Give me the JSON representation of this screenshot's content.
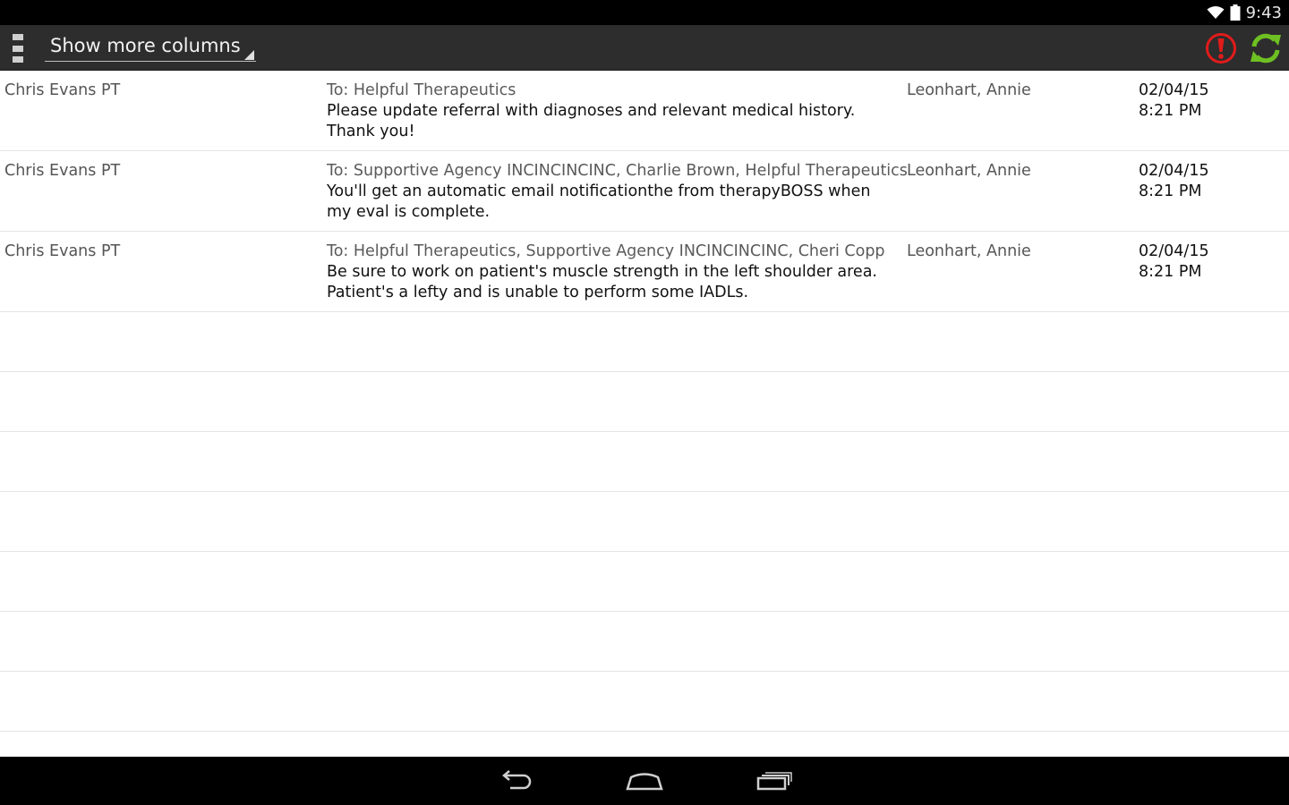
{
  "status_bar": {
    "time": "9:43",
    "icons": [
      "wifi-icon",
      "battery-icon"
    ]
  },
  "action_bar": {
    "overflow_icon": "overflow-menu-icon",
    "spinner_label": "Show more columns",
    "alert_icon": "alert-icon",
    "sync_icon": "sync-icon",
    "colors": {
      "alert": "#e21b1b",
      "sync": "#6ec022",
      "bar_background": "#2d2d2d"
    }
  },
  "messages": [
    {
      "sender": "Chris Evans PT",
      "to": "To: Helpful Therapeutics",
      "body": "Please update referral with diagnoses and relevant medical history. Thank you!",
      "patient": "Leonhart, Annie",
      "date": "02/04/15",
      "time": "8:21 PM"
    },
    {
      "sender": "Chris Evans PT",
      "to": "To: Supportive Agency INCINCINCINC, Charlie Brown, Helpful Therapeutics",
      "body": "You'll get an automatic email notificationthe from therapyBOSS when my eval is complete.",
      "patient": "Leonhart, Annie",
      "date": "02/04/15",
      "time": "8:21 PM"
    },
    {
      "sender": "Chris Evans PT",
      "to": "To: Helpful Therapeutics, Supportive Agency INCINCINCINC, Cheri Copp",
      "body": "Be sure to work on patient's muscle strength in the left shoulder area. Patient's a lefty and is unable to perform some IADLs.",
      "patient": "Leonhart, Annie",
      "date": "02/04/15",
      "time": "8:21 PM"
    }
  ],
  "nav_bar": {
    "icons": [
      "back-icon",
      "home-icon",
      "recent-apps-icon"
    ]
  }
}
